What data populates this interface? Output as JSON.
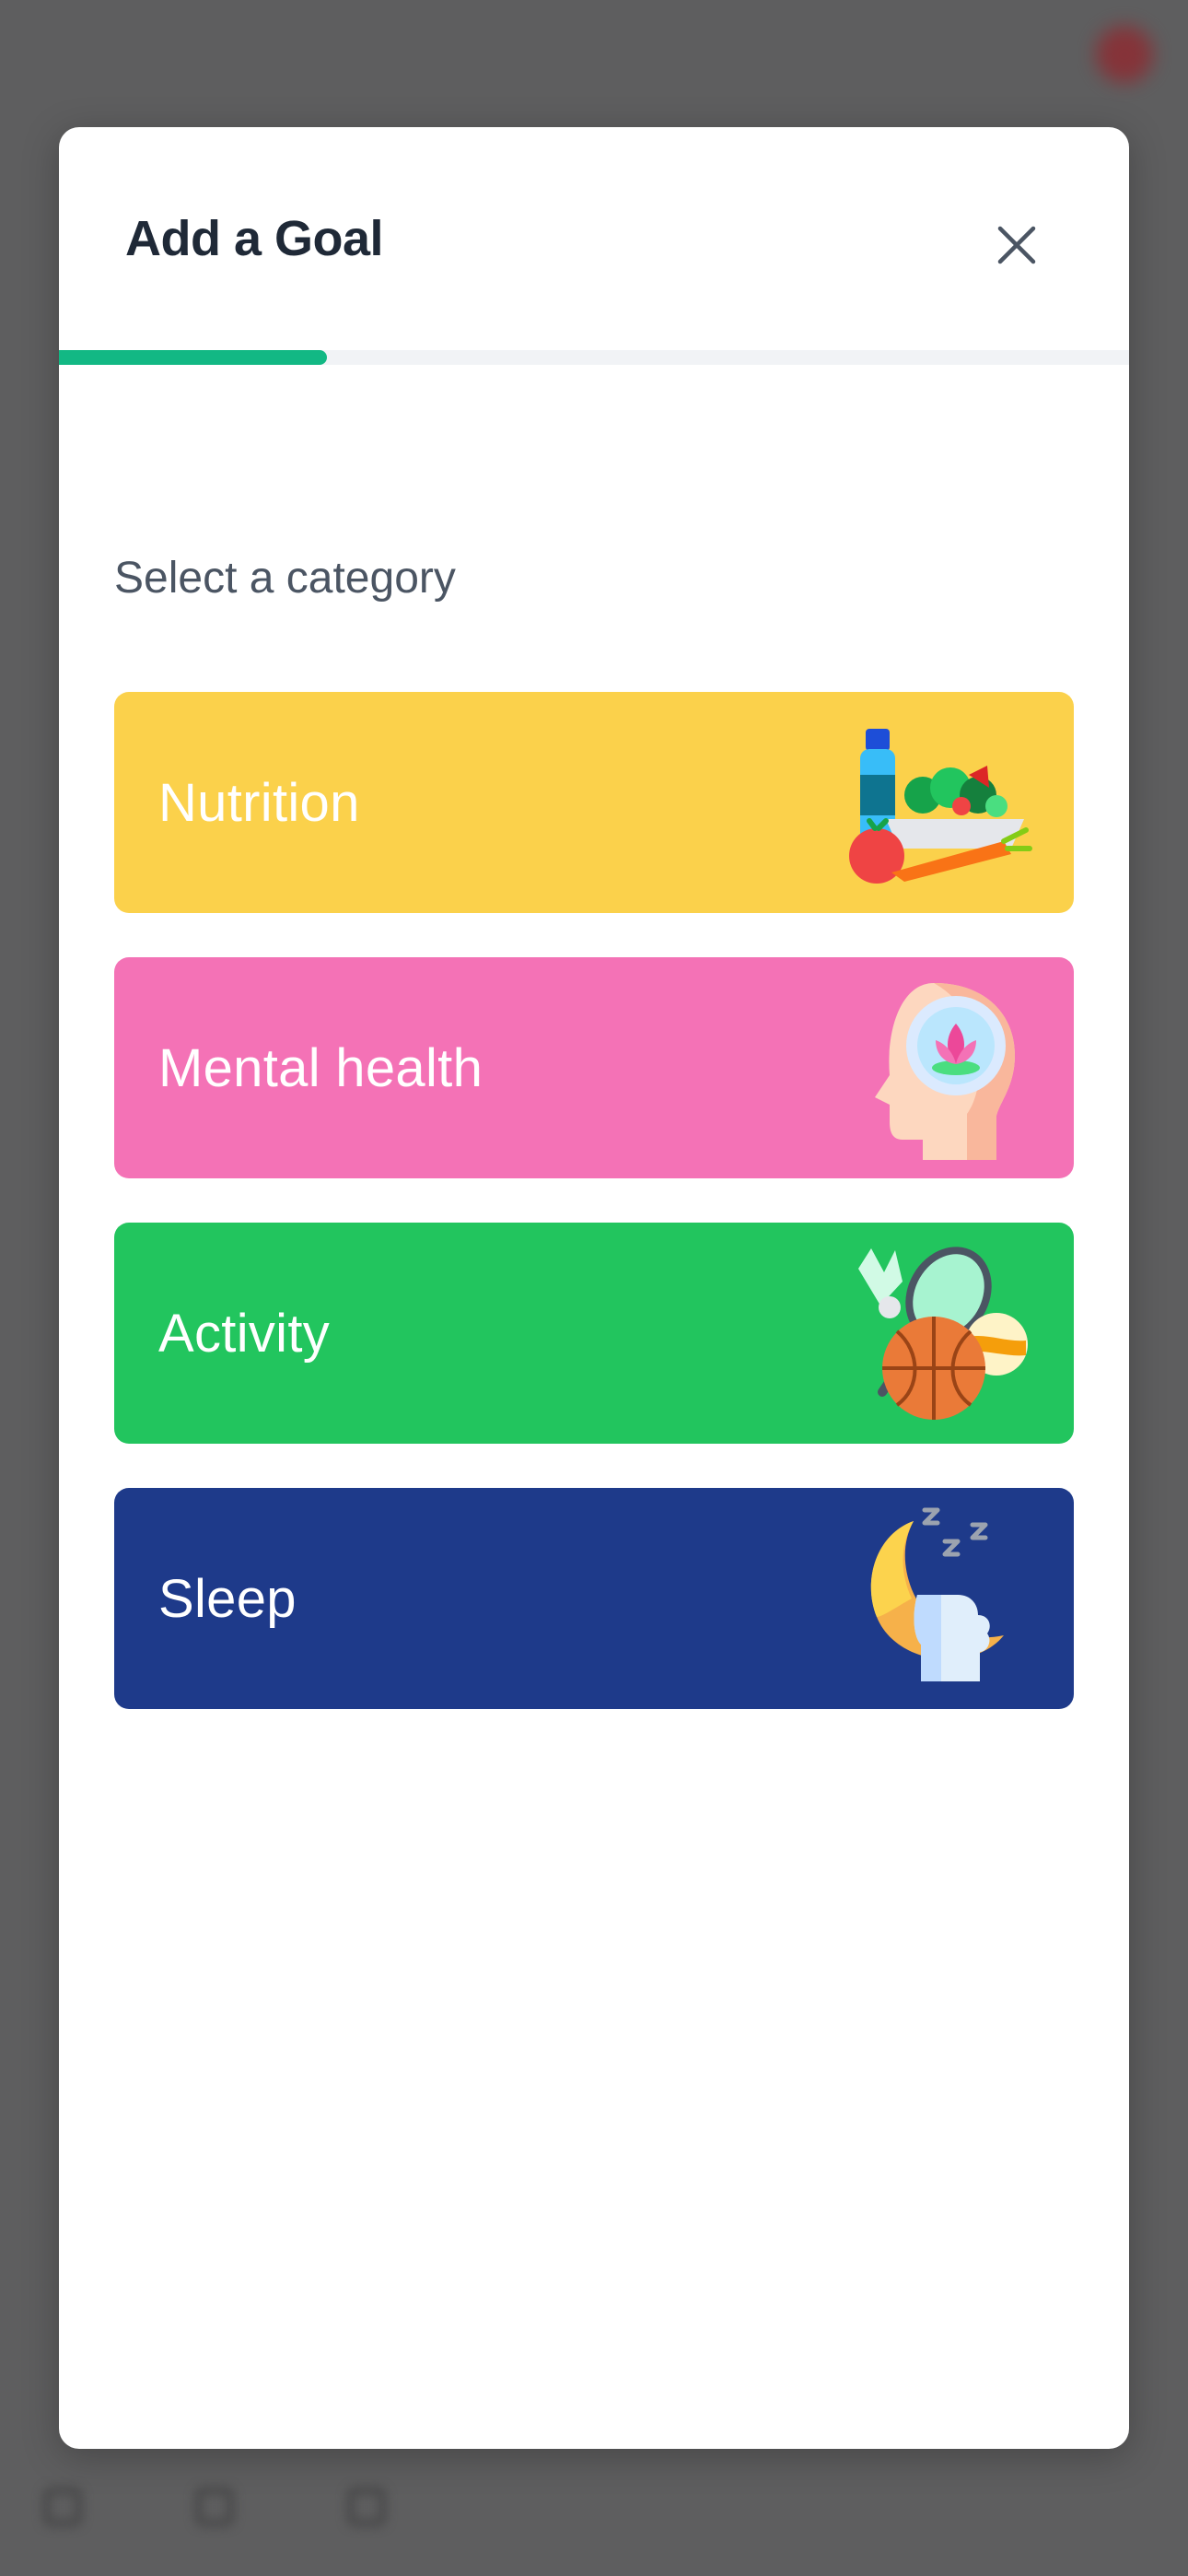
{
  "modal": {
    "title": "Add a Goal",
    "progress": 0.25,
    "section_label": "Select a category"
  },
  "categories": [
    {
      "label": "Nutrition",
      "color": "#fbd14b",
      "icon": "food-icon"
    },
    {
      "label": "Mental health",
      "color": "#f472b6",
      "icon": "meditation-head-icon"
    },
    {
      "label": "Activity",
      "color": "#22c55e",
      "icon": "sports-equipment-icon"
    },
    {
      "label": "Sleep",
      "color": "#1e3a8a",
      "icon": "moon-sleep-icon"
    }
  ],
  "colors": {
    "accent": "#12b884",
    "title": "#1f2937",
    "muted_text": "#4b5563",
    "overlay": "#5e5e5f"
  }
}
